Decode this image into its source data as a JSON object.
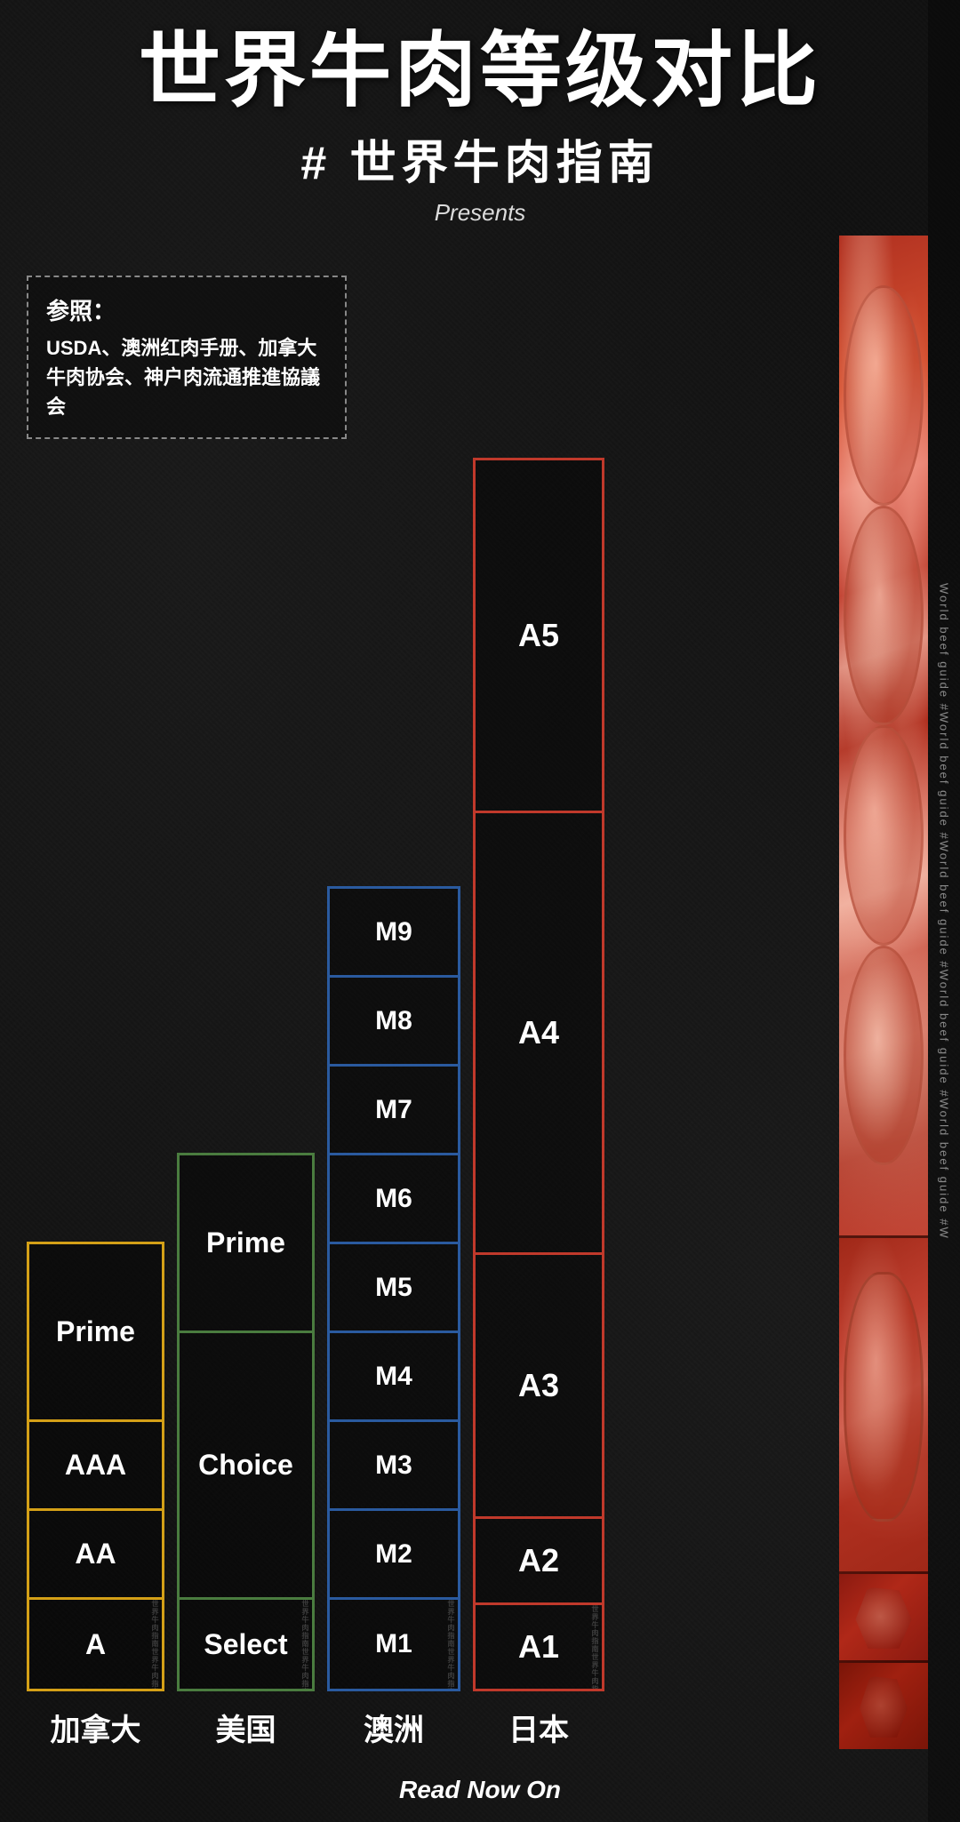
{
  "page": {
    "title": "世界牛肉等级对比",
    "subtitle": "# 世界牛肉指南",
    "presents": "Presents",
    "reference_label": "参照：",
    "reference_body": "USDA、澳洲红肉手册、加拿大牛肉协会、神户肉流通推進協議会",
    "side_text": "World beef guide #World beef guide #World beef guide #World beef guide #World beef guide #W",
    "footer": "Read Now On"
  },
  "columns": {
    "canada": {
      "label": "加拿大",
      "grades": [
        "Prime",
        "AAA",
        "AA",
        "A"
      ],
      "border_color": "#d4a017"
    },
    "usa": {
      "label": "美国",
      "grades": [
        "Prime",
        "Choice",
        "Select"
      ],
      "border_color": "#4a7c3f"
    },
    "australia": {
      "label": "澳洲",
      "grades": [
        "M9",
        "M8",
        "M7",
        "M6",
        "M5",
        "M4",
        "M3",
        "M2",
        "M1"
      ],
      "border_color": "#2a5a9f"
    },
    "japan": {
      "label": "日本",
      "grades": [
        "A5",
        "A4",
        "A3",
        "A2",
        "A1"
      ],
      "border_color": "#c0392b"
    }
  },
  "watermark_text": "世界牛肉指南 世界牛肉指南 世界牛肉指南 世界牛肉指南"
}
